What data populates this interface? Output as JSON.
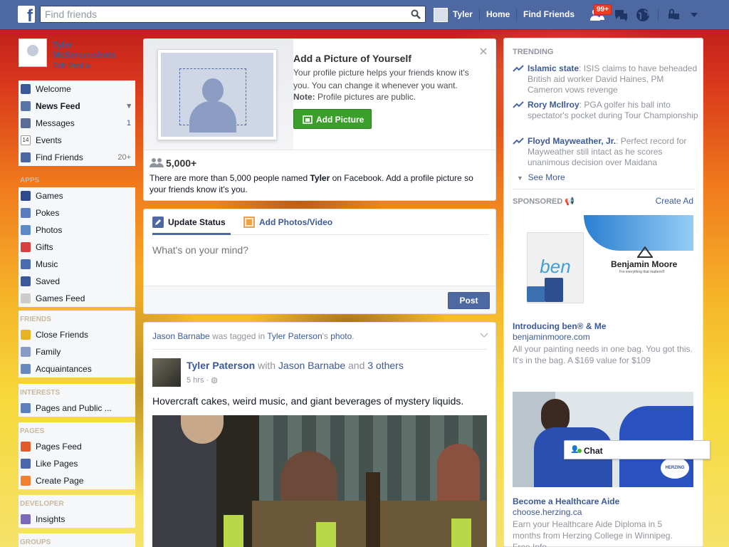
{
  "topbar": {
    "logo": "f",
    "search_placeholder": "Find friends",
    "user_name": "Tyler",
    "home": "Home",
    "find_friends": "Find Friends",
    "notif_count": "99+"
  },
  "sidebar": {
    "profile_name": "Tyler McScreenshots",
    "edit_profile": "Edit Profile",
    "main_items": [
      {
        "label": "Welcome",
        "count": ""
      },
      {
        "label": "News Feed",
        "count": ""
      },
      {
        "label": "Messages",
        "count": "1"
      },
      {
        "label": "Events",
        "count": ""
      },
      {
        "label": "Find Friends",
        "count": "20+"
      }
    ],
    "apps_header": "APPS",
    "apps": [
      "Games",
      "Pokes",
      "Photos",
      "Gifts",
      "Music",
      "Saved",
      "Games Feed"
    ],
    "friends_header": "FRIENDS",
    "friends": [
      "Close Friends",
      "Family",
      "Acquaintances"
    ],
    "interests_header": "INTERESTS",
    "interests": [
      "Pages and Public ..."
    ],
    "pages_header": "PAGES",
    "pages": [
      "Pages Feed",
      "Like Pages",
      "Create Page"
    ],
    "developer_header": "DEVELOPER",
    "developer": [
      "Insights"
    ],
    "groups_header": "GROUPS"
  },
  "add_picture": {
    "title": "Add a Picture of Yourself",
    "body": "Your profile picture helps your friends know it's you. You can change it whenever you want.",
    "note_label": "Note:",
    "note_text": "Profile pictures are public.",
    "button": "Add Picture",
    "count": "5,000+",
    "people_pre": "There are more than 5,000 people named ",
    "people_name": "Tyler",
    "people_post": " on Facebook. Add a profile picture so your friends know it's you."
  },
  "composer": {
    "tab_status": "Update Status",
    "tab_photos": "Add Photos/Video",
    "placeholder": "What's on your mind?",
    "post_button": "Post"
  },
  "story": {
    "header_actor": "Jason Barnabe",
    "header_mid": " was tagged in ",
    "header_owner": "Tyler Paterson",
    "header_possessive": "'s ",
    "header_photo": "photo",
    "header_end": ".",
    "author": "Tyler Paterson",
    "with_word": " with ",
    "tagged": "Jason Barnabe",
    "and_word": " and ",
    "others": "3 others",
    "time": "5 hrs",
    "text": "Hovercraft cakes, weird music, and giant beverages of mystery liquids."
  },
  "trending": {
    "header": "TRENDING",
    "items": [
      {
        "topic": "Islamic state",
        "desc": ": ISIS claims to have beheaded British aid worker David Haines, PM Cameron vows revenge"
      },
      {
        "topic": "Rory McIlroy",
        "desc": ": PGA golfer his ball into spectator's pocket during Tour Championship"
      },
      {
        "topic": "Floyd Mayweather, Jr.",
        "desc": ": Perfect record for Mayweather still intact as he scores unanimous decision over Maidana"
      }
    ],
    "see_more": "See More"
  },
  "sponsored": {
    "header": "SPONSORED",
    "create_ad": "Create Ad",
    "ad1": {
      "brand": "Benjamin Moore",
      "tagline": "For everything that matters®",
      "bag_text": "ben",
      "title": "Introducing ben® & Me",
      "url": "benjaminmoore.com",
      "desc": "All your painting needs in one bag. You got this. It's in the bag. A $169 value for $109"
    },
    "ad2": {
      "sign": "HERZING",
      "title": "Become a Healthcare Aide",
      "url": "choose.herzing.ca",
      "desc": "Earn your Healthcare Aide Diploma in 5 months from Herzing College in Winnipeg. Free Info"
    }
  },
  "chat": {
    "label": "Chat"
  },
  "colors": {
    "fb_blue": "#3b5998",
    "topbar": "#4e69a2",
    "green": "#3b9f2b"
  }
}
